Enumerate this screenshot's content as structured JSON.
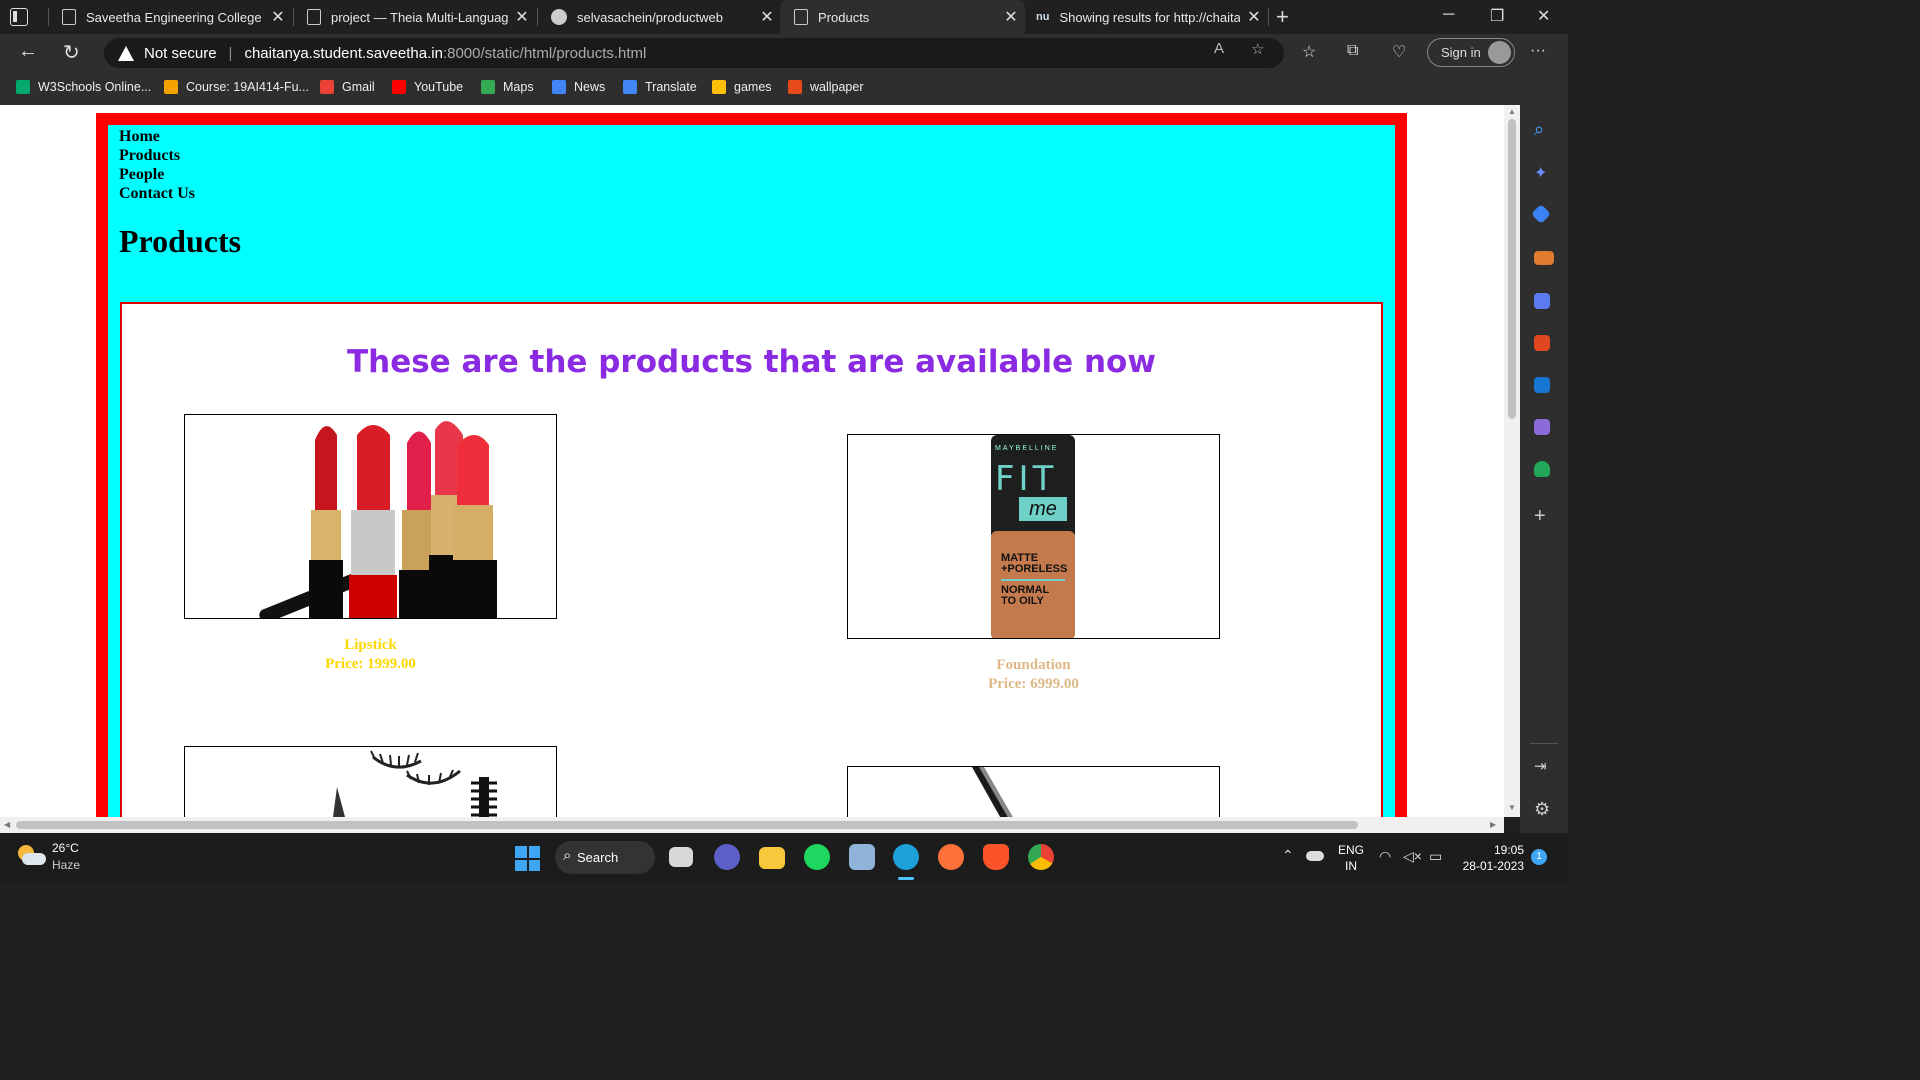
{
  "browser": {
    "tabs": [
      {
        "title": "Saveetha Engineering College",
        "icon": "page-icon"
      },
      {
        "title": "project — Theia Multi-Language",
        "icon": "page-icon"
      },
      {
        "title": "selvasachein/productweb",
        "icon": "github-icon"
      },
      {
        "title": "Products",
        "icon": "page-icon"
      },
      {
        "title": "Showing results for http://chaitar",
        "icon": "nu-icon"
      }
    ],
    "security_label": "Not secure",
    "url_host": "chaitanya.student.saveetha.in",
    "url_path": ":8000/static/html/products.html",
    "sign_in_label": "Sign in",
    "bookmarks": [
      {
        "label": "W3Schools Online...",
        "color": "#04aa6d"
      },
      {
        "label": "Course: 19AI414-Fu...",
        "color": "#f4a300"
      },
      {
        "label": "Gmail",
        "color": "#ea4335"
      },
      {
        "label": "YouTube",
        "color": "#ff0000"
      },
      {
        "label": "Maps",
        "color": "#34a853"
      },
      {
        "label": "News",
        "color": "#4285f4"
      },
      {
        "label": "Translate",
        "color": "#4285f4"
      },
      {
        "label": "games",
        "color": "#ffc107"
      },
      {
        "label": "wallpaper",
        "color": "#e64a19"
      }
    ]
  },
  "page": {
    "nav": [
      "Home",
      "Products",
      "People",
      "Contact Us"
    ],
    "title": "Products",
    "tagline": "These are the products that are available now",
    "products": [
      {
        "name": "Lipstick",
        "price": "Price: 1999.00",
        "color": "#ffd700"
      },
      {
        "name": "Foundation",
        "price": "Price: 6999.00",
        "color": "#deb887"
      }
    ],
    "foundation_label": {
      "brand": "MAYBELLINE",
      "line1": "FIT",
      "line2": "me",
      "desc1": "MATTE",
      "desc2": "+PORELESS",
      "desc3": "NORMAL",
      "desc4": "TO OILY"
    },
    "colors": {
      "outer_border": "#ff0000",
      "background": "#00ffff",
      "tagline": "#8a2be2"
    }
  },
  "taskbar": {
    "weather_temp": "26°C",
    "weather_desc": "Haze",
    "search_label": "Search",
    "lang": "ENG",
    "region": "IN",
    "time": "19:05",
    "date": "28-01-2023",
    "notification_count": "1"
  }
}
